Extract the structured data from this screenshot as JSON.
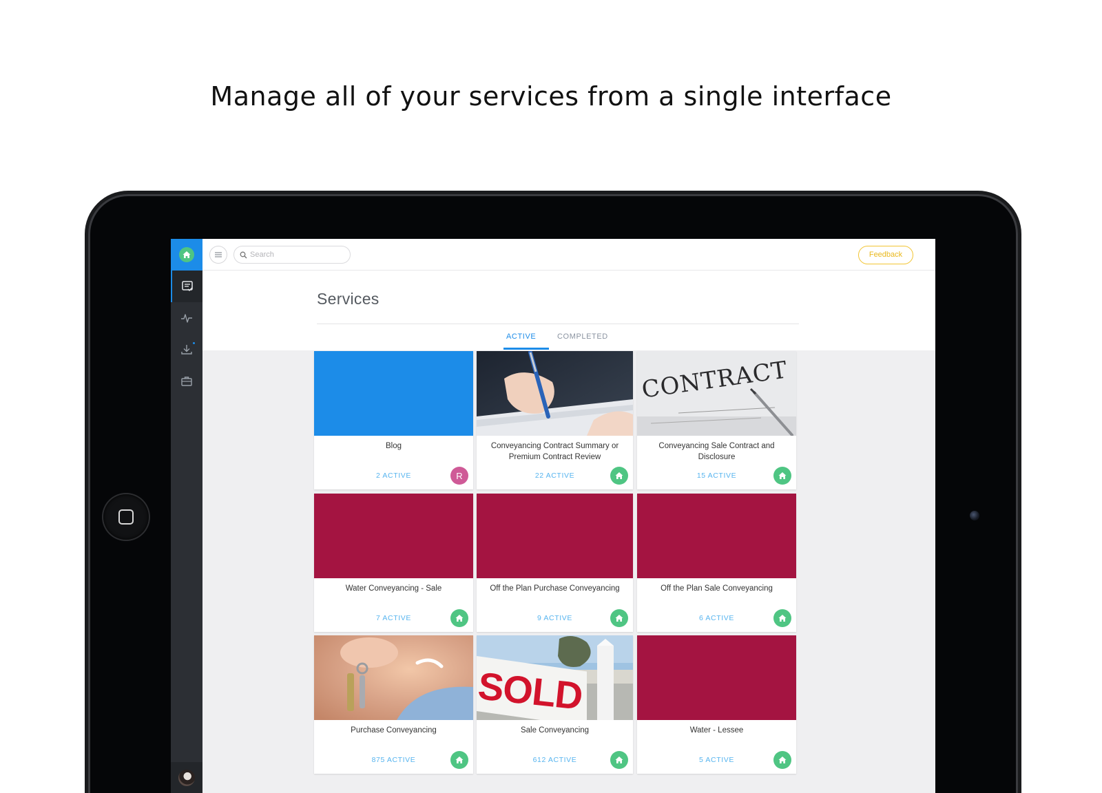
{
  "headline": "Manage all of your services from a single interface",
  "topbar": {
    "search_placeholder": "Search",
    "feedback_label": "Feedback"
  },
  "sidebar": {
    "items": [
      {
        "icon": "services-checklist-icon",
        "active": true
      },
      {
        "icon": "activity-pulse-icon",
        "active": false
      },
      {
        "icon": "download-icon",
        "active": false
      },
      {
        "icon": "briefcase-icon",
        "active": false
      }
    ]
  },
  "page": {
    "title": "Services",
    "tabs": [
      {
        "label": "ACTIVE",
        "active": true
      },
      {
        "label": "COMPLETED",
        "active": false
      }
    ]
  },
  "colors": {
    "accent": "#1c8ce8",
    "green": "#4fc583",
    "maroon": "#a41441",
    "feedback": "#f2c431",
    "count_text": "#56b4ef"
  },
  "services": [
    {
      "title": "Blog",
      "count": "2 ACTIVE",
      "image": "solid-blue",
      "badge": "R"
    },
    {
      "title": "Conveyancing Contract Summary or Premium Contract Review",
      "count": "22 ACTIVE",
      "image": "photo-hand-signing",
      "badge": "home-icon"
    },
    {
      "title": "Conveyancing Sale Contract and Disclosure",
      "count": "15 ACTIVE",
      "image": "photo-contract",
      "badge": "home-icon",
      "image_text": "CONTRACT"
    },
    {
      "title": "Water Conveyancing - Sale",
      "count": "7 ACTIVE",
      "image": "solid-maroon",
      "badge": "home-icon"
    },
    {
      "title": "Off the Plan Purchase Conveyancing",
      "count": "9 ACTIVE",
      "image": "solid-maroon",
      "badge": "home-icon"
    },
    {
      "title": "Off the Plan Sale Conveyancing",
      "count": "6 ACTIVE",
      "image": "solid-maroon",
      "badge": "home-icon"
    },
    {
      "title": "Purchase Conveyancing",
      "count": "875 ACTIVE",
      "image": "photo-keys",
      "badge": "home-icon"
    },
    {
      "title": "Sale Conveyancing",
      "count": "612 ACTIVE",
      "image": "photo-sold-sign",
      "badge": "home-icon",
      "image_text": "SOLD"
    },
    {
      "title": "Water - Lessee",
      "count": "5 ACTIVE",
      "image": "solid-maroon",
      "badge": "home-icon"
    }
  ]
}
